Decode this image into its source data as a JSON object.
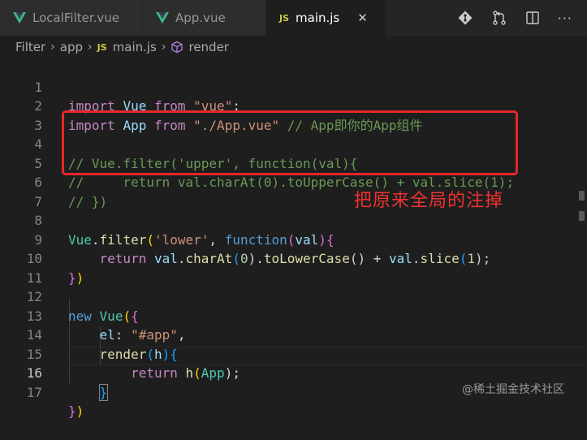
{
  "tabs": [
    {
      "label": "LocalFilter.vue",
      "icon": "vue-icon",
      "active": false
    },
    {
      "label": "App.vue",
      "icon": "vue-icon",
      "active": false
    },
    {
      "label": "main.js",
      "icon": "js-icon",
      "active": true
    }
  ],
  "js_icon_text": "JS",
  "close_glyph": "✕",
  "actions": [
    "git-compare-icon",
    "pull-request-icon",
    "split-editor-icon",
    "more-icon"
  ],
  "more_glyph": "···",
  "breadcrumb": {
    "items": [
      "Filter",
      "app",
      "main.js",
      "render"
    ],
    "separator": "›"
  },
  "code": {
    "line_numbers": [
      "1",
      "2",
      "3",
      "4",
      "5",
      "6",
      "7",
      "8",
      "9",
      "10",
      "11",
      "12",
      "13",
      "14",
      "15",
      "16",
      "17"
    ],
    "l1": {
      "t0": "import",
      "t1": "Vue",
      "t2": "from",
      "t3": "\"vue\"",
      "t4": ";"
    },
    "l2": {
      "t0": "import",
      "t1": "App",
      "t2": "from",
      "t3": "\"./App.vue\"",
      "t4": "// App即你的App组件"
    },
    "l4": "// Vue.filter('upper', function(val){",
    "l5": "//     return val.charAt(0).toUpperCase() + val.slice(1);",
    "l6": "// })",
    "l8": {
      "t0": "Vue",
      "t1": ".",
      "t2": "filter",
      "t3": "(",
      "t4": "'lower'",
      "t5": ", ",
      "t6": "function",
      "t7": "(",
      "t8": "val",
      "t9": ")",
      "t10": "{"
    },
    "l9": {
      "t0": "return",
      "t1": "val",
      "t2": ".",
      "t3": "charAt",
      "t4": "(",
      "t5": "0",
      "t6": ").",
      "t7": "toLowerCase",
      "t8": "() + ",
      "t9": "val",
      "t10": ".",
      "t11": "slice",
      "t12": "(",
      "t13": "1",
      "t14": ");"
    },
    "l10": {
      "t0": "}",
      "t1": ")"
    },
    "l12": {
      "t0": "new",
      "t1": "Vue",
      "t2": "(",
      "t3": "{"
    },
    "l13": {
      "t0": "el",
      "t1": ": ",
      "t2": "\"#app\"",
      "t3": ","
    },
    "l14": {
      "t0": "render",
      "t1": "(",
      "t2": "h",
      "t3": ")",
      "t4": "{"
    },
    "l15": {
      "t0": "return",
      "t1": "h",
      "t2": "(",
      "t3": "App",
      "t4": ");"
    },
    "l16": "}",
    "l17": {
      "t0": "}",
      "t1": ")"
    }
  },
  "annotation": "把原来全局的注掉",
  "watermark": "@稀土掘金技术社区",
  "colors": {
    "annotation_red": "#e8272a",
    "editor_bg": "#1e1e1e",
    "tab_bar_bg": "#252526"
  }
}
